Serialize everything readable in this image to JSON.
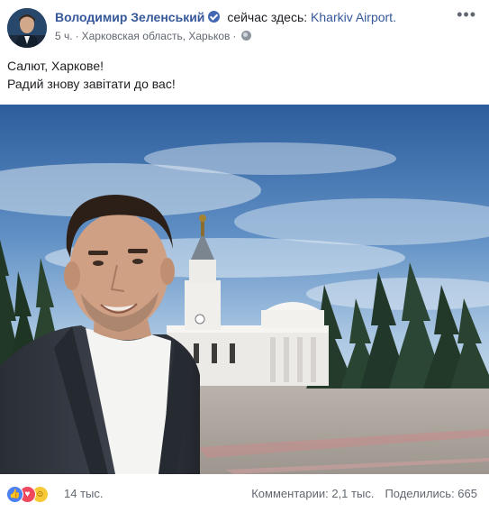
{
  "post": {
    "author": "Володимир Зеленський",
    "location_prefix": "сейчас здесь:",
    "location": "Kharkiv Airport.",
    "time": "5 ч.",
    "place": "Харковская область, Харьков",
    "text_line1": "Салют, Харкове!",
    "text_line2": "Радий знову завітати до вас!"
  },
  "icons": {
    "verified": "verified-badge-icon",
    "privacy": "globe-icon",
    "menu": "more-options-icon",
    "reactions": [
      "like-icon",
      "love-icon",
      "haha-icon"
    ]
  },
  "footer": {
    "reactions_count": "14 тыс.",
    "comments": "Комментарии: 2,1 тыс.",
    "shares": "Поделились: 665"
  },
  "colors": {
    "link": "#365899",
    "like": "#4a80f3",
    "love": "#f0495e",
    "haha": "#f7c935"
  }
}
